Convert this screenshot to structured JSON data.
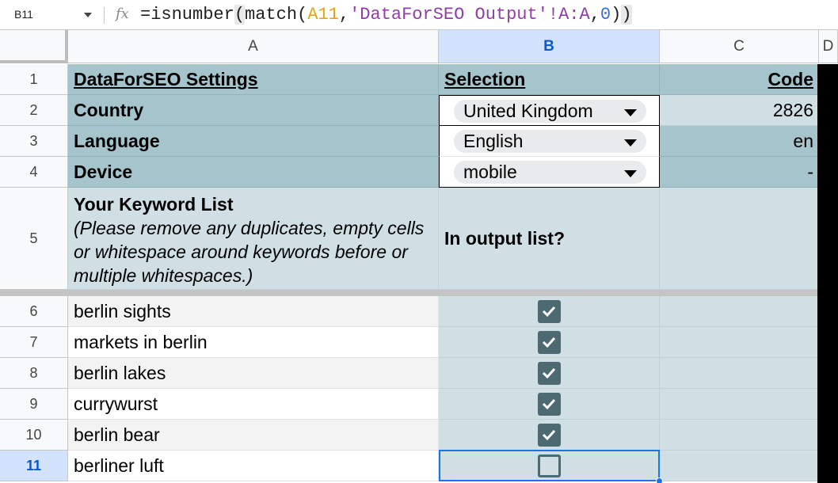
{
  "formula_bar": {
    "name_box": "B11",
    "fx_label": "fx",
    "formula": {
      "p1": "=isnumber",
      "p2": "(",
      "p3": "match(",
      "ref": "A11",
      "comma1": ",",
      "str": "'DataForSEO Output'!A:A",
      "comma2": ",",
      "num": "0",
      "p4": ")",
      "p5": ")"
    }
  },
  "columns": [
    "A",
    "B",
    "C",
    "D"
  ],
  "rows": [
    "1",
    "2",
    "3",
    "4",
    "5",
    "6",
    "7",
    "8",
    "9",
    "10",
    "11"
  ],
  "settings": {
    "title": "DataForSEO Settings",
    "selection_header": "Selection",
    "code_header": "Code",
    "country_label": "Country",
    "country_value": "United Kingdom",
    "country_code": "2826",
    "language_label": "Language",
    "language_value": "English",
    "language_code": "en",
    "device_label": "Device",
    "device_value": "mobile",
    "device_code": "-"
  },
  "keyword_section": {
    "title": "Your Keyword List",
    "note": "(Please remove any duplicates, empty cells or whitespace around keywords before or multiple whitespaces.)",
    "output_header": "In output list?"
  },
  "keywords": [
    {
      "text": "berlin sights",
      "in_output": true
    },
    {
      "text": "markets in berlin",
      "in_output": true
    },
    {
      "text": "berlin lakes",
      "in_output": true
    },
    {
      "text": "currywurst",
      "in_output": true
    },
    {
      "text": "berlin bear",
      "in_output": true
    },
    {
      "text": "berliner luft",
      "in_output": false
    }
  ],
  "selected_cell": "B11",
  "colors": {
    "header_teal": "#a5c4cb",
    "light_teal": "#d0dfe3",
    "checkbox": "#4d6a72",
    "selection": "#1a73e8"
  }
}
